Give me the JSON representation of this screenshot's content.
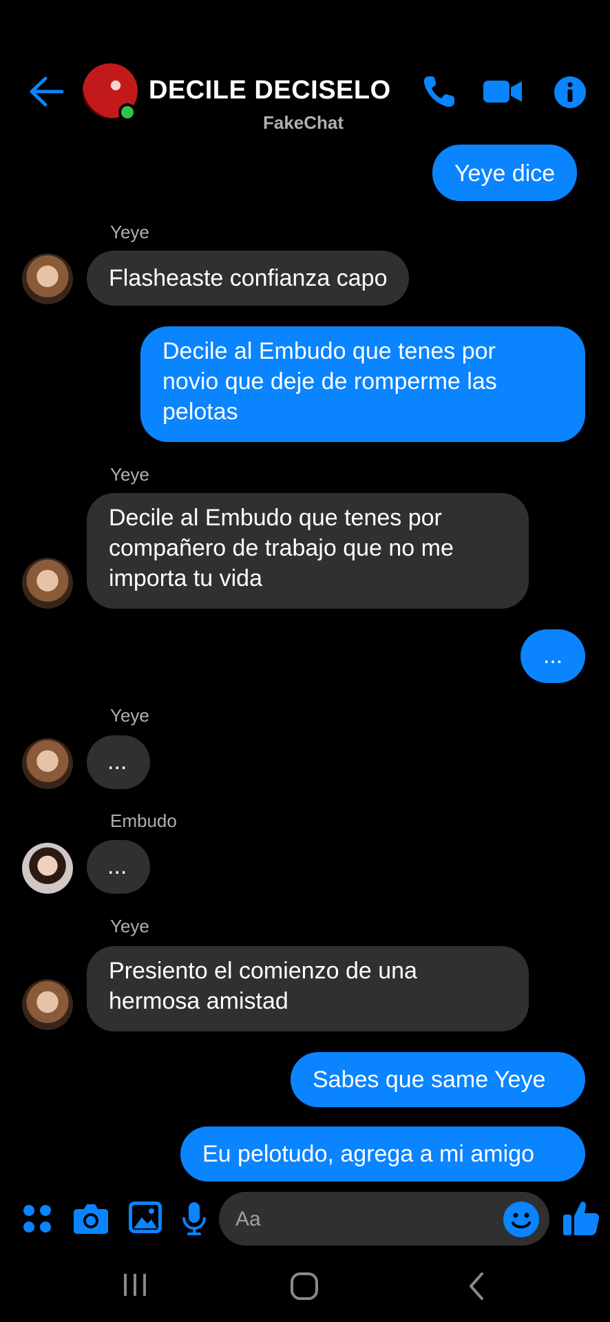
{
  "header": {
    "title": "DECILE DECISELO",
    "subtitle": "FakeChat",
    "accent": "#0a84ff"
  },
  "messages": {
    "m1": "Yeye dice",
    "s2": "Yeye",
    "m2": "Flasheaste confianza capo",
    "m3_l1": "Decile al Embudo que tenes por",
    "m3_l2": "novio que deje de romperme las",
    "m3_l3": "pelotas",
    "s4": "Yeye",
    "m4_l1": "Decile al Embudo que tenes por",
    "m4_l2": "compañero de trabajo que no me",
    "m4_l3": "importa tu vida",
    "m5": "...",
    "s6": "Yeye",
    "m6": "...",
    "s7": "Embudo",
    "m7": "...",
    "s8": "Yeye",
    "m8_l1": "Presiento el comienzo de una",
    "m8_l2": "hermosa amistad",
    "m9": "Sabes que same Yeye",
    "m10": "Eu pelotudo, agrega a mi amigo"
  },
  "composer": {
    "placeholder": "Aa"
  },
  "icons": [
    "back-arrow-icon",
    "phone-icon",
    "video-camera-icon",
    "info-icon",
    "apps-grid-icon",
    "camera-icon",
    "image-icon",
    "microphone-icon",
    "emoji-icon",
    "thumbs-up-icon",
    "recent-apps-icon",
    "home-icon",
    "back-nav-icon"
  ]
}
